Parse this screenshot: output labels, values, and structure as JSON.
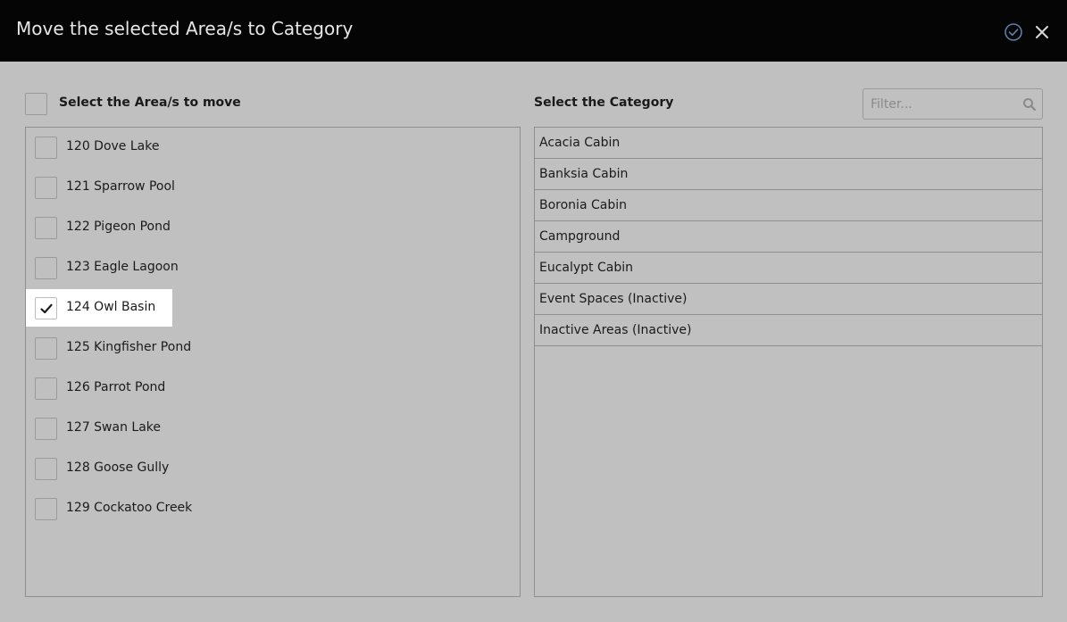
{
  "dialog": {
    "title": "Move the selected Area/s to Category",
    "confirm_icon": "check-circle-icon",
    "close_icon": "close-icon"
  },
  "areas": {
    "select_all_label": "Select the Area/s to move",
    "select_all_checked": false,
    "items": [
      {
        "label": "120 Dove Lake",
        "checked": false
      },
      {
        "label": "121 Sparrow Pool",
        "checked": false
      },
      {
        "label": "122 Pigeon Pond",
        "checked": false
      },
      {
        "label": "123 Eagle Lagoon",
        "checked": false
      },
      {
        "label": "124 Owl Basin",
        "checked": true
      },
      {
        "label": "125 Kingfisher Pond",
        "checked": false
      },
      {
        "label": "126 Parrot Pond",
        "checked": false
      },
      {
        "label": "127 Swan Lake",
        "checked": false
      },
      {
        "label": "128 Goose Gully",
        "checked": false
      },
      {
        "label": "129 Cockatoo Creek",
        "checked": false
      }
    ]
  },
  "category": {
    "heading": "Select the Category",
    "filter": {
      "placeholder": "Filter...",
      "value": "",
      "icon": "search-icon"
    },
    "items": [
      {
        "label": "Acacia Cabin"
      },
      {
        "label": "Banksia Cabin"
      },
      {
        "label": "Boronia Cabin"
      },
      {
        "label": "Campground"
      },
      {
        "label": "Eucalypt Cabin"
      },
      {
        "label": "Event Spaces (Inactive)"
      },
      {
        "label": "Inactive Areas (Inactive)"
      }
    ]
  },
  "colors": {
    "titlebar": "#050505",
    "background": "#c0c0c0",
    "selected_row": "#ffffff",
    "accent_icon": "#5a7fa8"
  }
}
